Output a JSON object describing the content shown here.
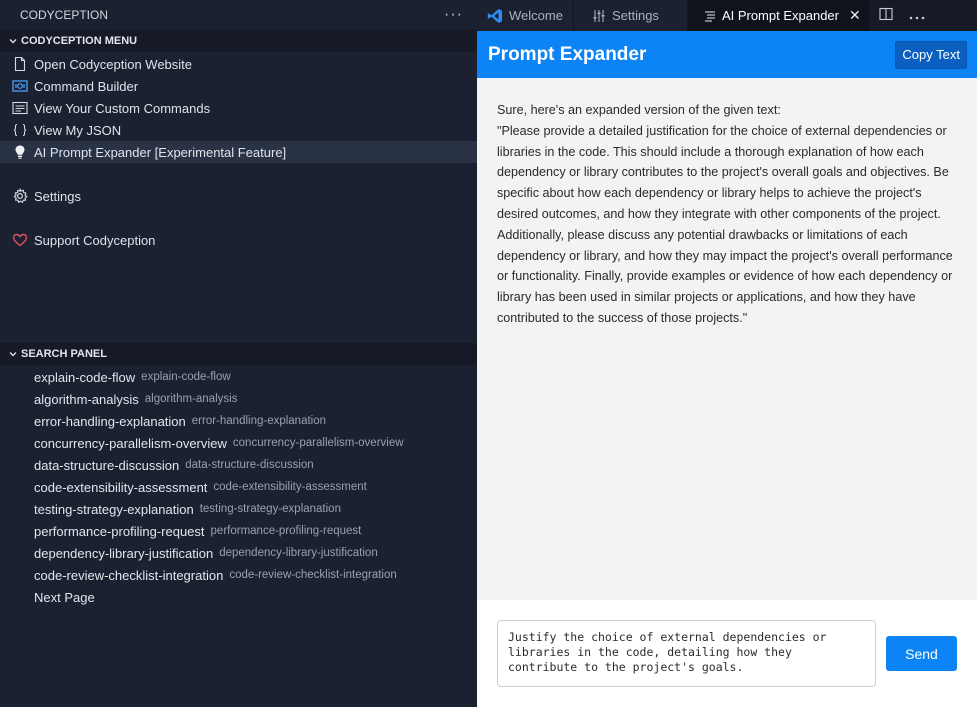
{
  "sidebar": {
    "title": "CODYCEPTION",
    "title_more": "···",
    "menu_header": "CODYCEPTION MENU",
    "menu_items": [
      {
        "label": "Open Codyception Website",
        "icon": "file-icon"
      },
      {
        "label": "Command Builder",
        "icon": "command-builder-icon"
      },
      {
        "label": "View Your Custom Commands",
        "icon": "list-icon"
      },
      {
        "label": "View My JSON",
        "icon": "json-braces-icon"
      },
      {
        "label": "AI Prompt Expander [Experimental Feature]",
        "icon": "lightbulb-icon",
        "selected": true
      }
    ],
    "settings_label": "Settings",
    "support_label": "Support Codyception",
    "search_header": "SEARCH PANEL",
    "search_items": [
      {
        "label": "explain-code-flow",
        "desc": "explain-code-flow"
      },
      {
        "label": "algorithm-analysis",
        "desc": "algorithm-analysis"
      },
      {
        "label": "error-handling-explanation",
        "desc": "error-handling-explanation"
      },
      {
        "label": "concurrency-parallelism-overview",
        "desc": "concurrency-parallelism-overview"
      },
      {
        "label": "data-structure-discussion",
        "desc": "data-structure-discussion"
      },
      {
        "label": "code-extensibility-assessment",
        "desc": "code-extensibility-assessment"
      },
      {
        "label": "testing-strategy-explanation",
        "desc": "testing-strategy-explanation"
      },
      {
        "label": "performance-profiling-request",
        "desc": "performance-profiling-request"
      },
      {
        "label": "dependency-library-justification",
        "desc": "dependency-library-justification"
      },
      {
        "label": "code-review-checklist-integration",
        "desc": "code-review-checklist-integration"
      }
    ],
    "next_page_label": "Next Page"
  },
  "tabs": [
    {
      "label": "Welcome",
      "icon": "vscode-logo-icon"
    },
    {
      "label": "Settings",
      "icon": "settings-sliders-icon"
    },
    {
      "label": "AI Prompt Expander",
      "icon": "preview-icon",
      "active": true,
      "close": "✕"
    }
  ],
  "webview": {
    "title": "Prompt Expander",
    "copy_label": "Copy Text",
    "response_intro": "Sure, here's an expanded version of the given text:",
    "response_text": "\"Please provide a detailed justification for the choice of external dependencies or libraries in the code. This should include a thorough explanation of how each dependency or library contributes to the project's overall goals and objectives. Be specific about how each dependency or library helps to achieve the project's desired outcomes, and how they integrate with other components of the project. Additionally, please discuss any potential drawbacks or limitations of each dependency or library, and how they may impact the project's overall performance or functionality. Finally, provide examples or evidence of how each dependency or library has been used in similar projects or applications, and how they have contributed to the success of those projects.\"",
    "prompt_value": "Justify the choice of external dependencies or libraries in the code, detailing how they contribute to the project's goals.",
    "send_label": "Send"
  },
  "colors": {
    "accent": "#0d84f5",
    "sidebar_bg": "#1b2130",
    "heart": "#e05260",
    "vscode_blue": "#2f8cf0"
  }
}
